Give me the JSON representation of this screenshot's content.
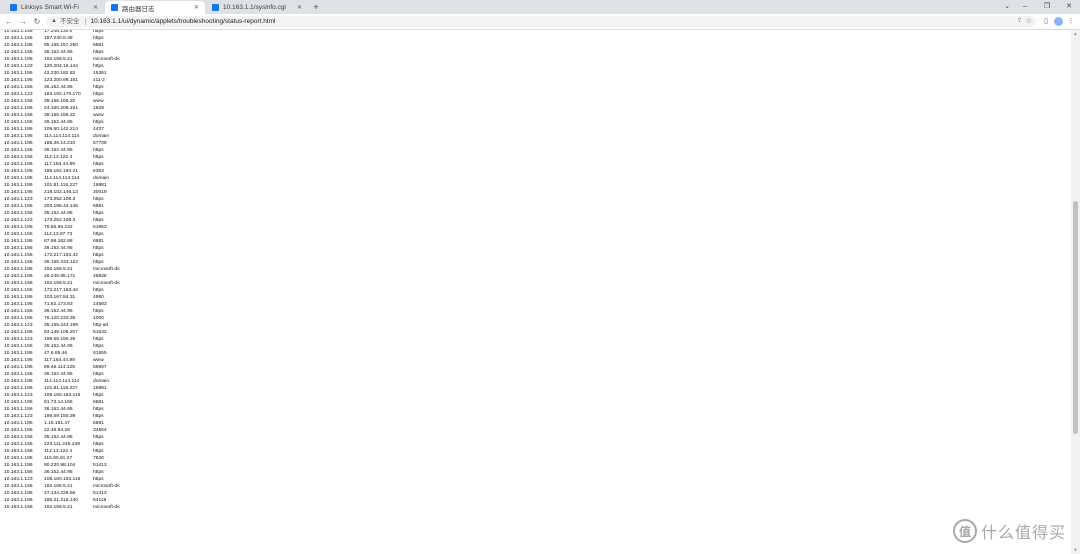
{
  "tabs": [
    {
      "label": "Linksys Smart Wi-Fi",
      "active": false
    },
    {
      "label": "路由器日志",
      "active": true
    },
    {
      "label": "10.163.1.1/sysinfo.cgi",
      "active": false
    }
  ],
  "address": {
    "security": "不安全",
    "url": "10.163.1.1/ui/dynamic/applets/troubleshooting/status-report.html"
  },
  "scroll": {
    "thumb_start": 0.32,
    "thumb_end": 0.78
  },
  "rows": [
    [
      "10.163.1.156",
      "17.248.130.x",
      "https"
    ],
    [
      "10.163.1.156",
      "157.240.8.38",
      "https"
    ],
    [
      "10.163.1.195",
      "95.165.157.250",
      "6881"
    ],
    [
      "10.163.1.156",
      "36.152.44.95",
      "https"
    ],
    [
      "10.163.1.195",
      "192.168.5.21",
      "microsoft-ds"
    ],
    [
      "10.163.1.123",
      "120.204.16.144",
      "https"
    ],
    [
      "10.163.1.195",
      "42.230.192.82",
      "15361"
    ],
    [
      "10.163.1.195",
      "123.200.99.151",
      "x11-2"
    ],
    [
      "10.163.1.156",
      "36.152.44.95",
      "https"
    ],
    [
      "10.163.1.123",
      "183.192.170.170",
      "https"
    ],
    [
      "10.163.1.156",
      "39.156.165.32",
      "www"
    ],
    [
      "10.163.1.195",
      "24.150.206.151",
      "1829"
    ],
    [
      "10.163.1.156",
      "39.156.165.32",
      "www"
    ],
    [
      "10.163.1.156",
      "36.152.44.95",
      "https"
    ],
    [
      "10.163.1.195",
      "109.50.142.214",
      "4437"
    ],
    [
      "10.163.1.195",
      "114.114.114.114",
      "domain"
    ],
    [
      "10.163.1.195",
      "185.38.14.210",
      "57739"
    ],
    [
      "10.163.1.156",
      "36.152.44.95",
      "https"
    ],
    [
      "10.163.1.156",
      "112.13.122.4",
      "https"
    ],
    [
      "10.163.1.195",
      "117.184.44.99",
      "https"
    ],
    [
      "10.163.1.195",
      "185.162.184.21",
      "6363"
    ],
    [
      "10.163.1.195",
      "114.114.114.114",
      "domain"
    ],
    [
      "10.163.1.195",
      "101.81.118.227",
      "16881"
    ],
    [
      "10.163.1.195",
      "218.102.146.13",
      "30019"
    ],
    [
      "10.163.1.123",
      "173.252.108.3",
      "https"
    ],
    [
      "10.163.1.195",
      "203.186.44.146",
      "6881"
    ],
    [
      "10.163.1.156",
      "36.152.44.95",
      "https"
    ],
    [
      "10.163.1.123",
      "173.252.108.3",
      "https"
    ],
    [
      "10.163.1.195",
      "78.56.96.232",
      "51963"
    ],
    [
      "10.163.1.156",
      "112.13.87.73",
      "https"
    ],
    [
      "10.163.1.195",
      "87.98.162.88",
      "6881"
    ],
    [
      "10.163.1.156",
      "36.152.44.95",
      "https"
    ],
    [
      "10.163.1.156",
      "172.217.163.42",
      "https"
    ],
    [
      "10.163.1.156",
      "36.155.233.122",
      "https"
    ],
    [
      "10.163.1.195",
      "192.168.5.21",
      "microsoft-ds"
    ],
    [
      "10.163.1.195",
      "46.246.85.171",
      "46838"
    ],
    [
      "10.163.1.156",
      "192.168.5.21",
      "microsoft-ds"
    ],
    [
      "10.163.1.156",
      "172.217.163.42",
      "https"
    ],
    [
      "10.163.1.195",
      "103.167.84.31",
      "4950"
    ],
    [
      "10.163.1.195",
      "71.62.173.83",
      "14583"
    ],
    [
      "10.163.1.156",
      "36.152.44.95",
      "https"
    ],
    [
      "10.163.1.195",
      "76.120.233.35",
      "1000"
    ],
    [
      "10.163.1.123",
      "36.155.244.199",
      "http-alt"
    ],
    [
      "10.163.1.195",
      "83.149.106.207",
      "51532"
    ],
    [
      "10.163.1.123",
      "199.59.150.39",
      "https"
    ],
    [
      "10.163.1.156",
      "36.152.44.95",
      "https"
    ],
    [
      "10.163.1.195",
      "47.6.65.46",
      "61555"
    ],
    [
      "10.163.1.195",
      "117.184.44.99",
      "www"
    ],
    [
      "10.163.1.195",
      "89.46.114.125",
      "59687"
    ],
    [
      "10.163.1.156",
      "36.152.44.95",
      "https"
    ],
    [
      "10.163.1.195",
      "114.114.114.114",
      "domain"
    ],
    [
      "10.163.1.195",
      "101.81.118.227",
      "16881"
    ],
    [
      "10.163.1.123",
      "108.160.163.116",
      "https"
    ],
    [
      "10.163.1.195",
      "81.73.14.155",
      "6881"
    ],
    [
      "10.163.1.156",
      "36.152.44.95",
      "https"
    ],
    [
      "10.163.1.123",
      "199.59.150.39",
      "https"
    ],
    [
      "10.163.1.195",
      "1.15.181.47",
      "6881"
    ],
    [
      "10.163.1.195",
      "42.48.94.28",
      "34564"
    ],
    [
      "10.163.1.156",
      "36.152.44.95",
      "https"
    ],
    [
      "10.163.1.156",
      "223.111.245.249",
      "https"
    ],
    [
      "10.163.1.156",
      "112.13.122.4",
      "https"
    ],
    [
      "10.163.1.195",
      "115.90.91.27",
      "7620"
    ],
    [
      "10.163.1.195",
      "90.230.98.104",
      "51413"
    ],
    [
      "10.163.1.156",
      "36.152.44.95",
      "https"
    ],
    [
      "10.163.1.123",
      "108.160.163.116",
      "https"
    ],
    [
      "10.163.1.156",
      "192.168.5.21",
      "microsoft-ds"
    ],
    [
      "10.163.1.195",
      "47.134.228.56",
      "51413"
    ],
    [
      "10.163.1.195",
      "185.21.216.140",
      "64118"
    ],
    [
      "10.163.1.156",
      "192.168.5.21",
      "microsoft-ds"
    ]
  ],
  "watermark": {
    "logo": "值",
    "text": "什么值得买"
  }
}
